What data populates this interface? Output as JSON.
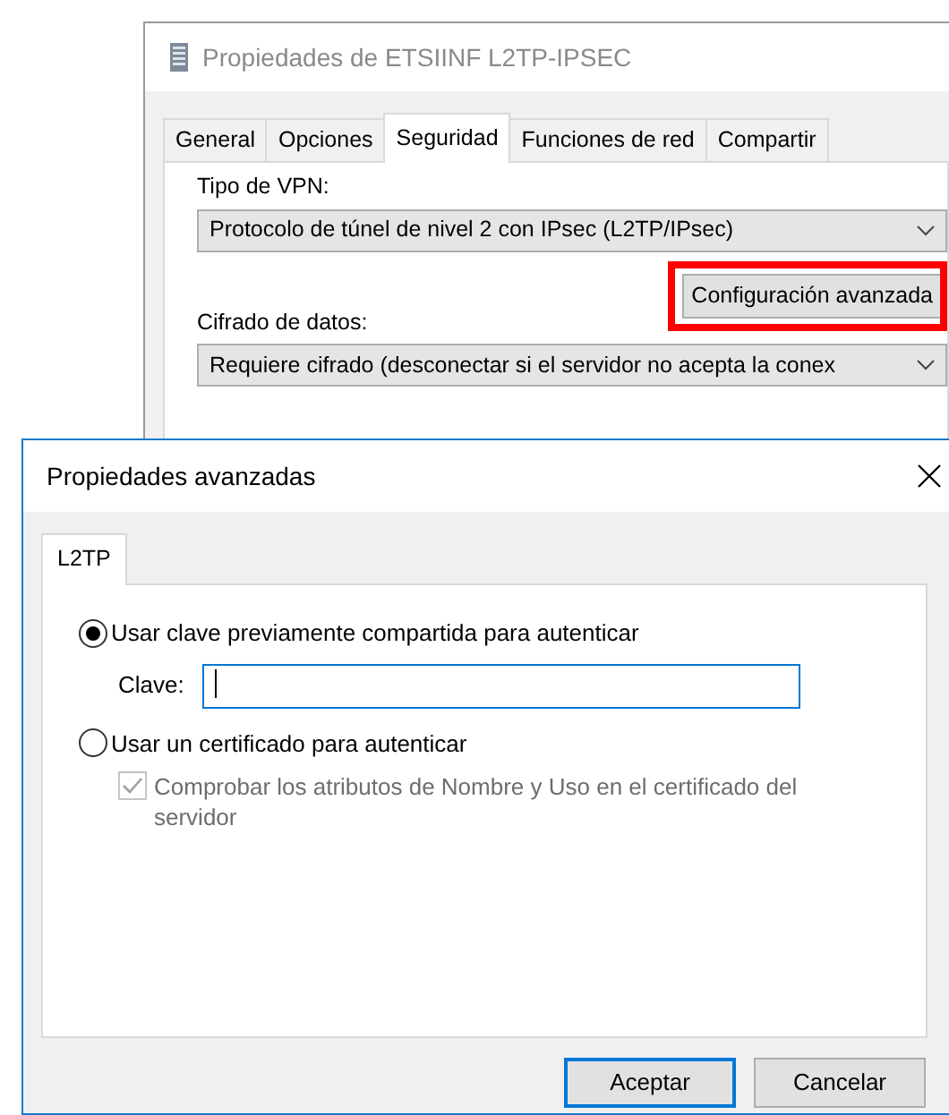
{
  "back_window": {
    "title": "Propiedades de ETSIINF L2TP-IPSEC",
    "tabs": [
      {
        "label": "General",
        "selected": false
      },
      {
        "label": "Opciones",
        "selected": false
      },
      {
        "label": "Seguridad",
        "selected": true
      },
      {
        "label": "Funciones de red",
        "selected": false
      },
      {
        "label": "Compartir",
        "selected": false
      }
    ],
    "vpn_type": {
      "label": "Tipo de VPN:",
      "value": "Protocolo de túnel de nivel 2 con IPsec (L2TP/IPsec)"
    },
    "advanced_button": {
      "label": "Configuración avanzada",
      "highlighted": true
    },
    "encryption": {
      "label": "Cifrado de datos:",
      "value": "Requiere cifrado (desconectar si el servidor no acepta la conex"
    }
  },
  "dialog": {
    "title": "Propiedades avanzadas",
    "tabs": [
      {
        "label": "L2TP",
        "selected": true
      }
    ],
    "options": [
      {
        "label": "Usar clave previamente compartida para autenticar",
        "selected": true
      },
      {
        "label": "Usar un certificado para autenticar",
        "selected": false
      }
    ],
    "key_field": {
      "label": "Clave:",
      "focused": true
    },
    "checkbox": {
      "label": "Comprobar los atributos de Nombre y Uso en el certificado del servidor",
      "checked": true,
      "disabled": true
    },
    "buttons": [
      {
        "label": "Aceptar",
        "default": true
      },
      {
        "label": "Cancelar",
        "default": false
      }
    ]
  }
}
